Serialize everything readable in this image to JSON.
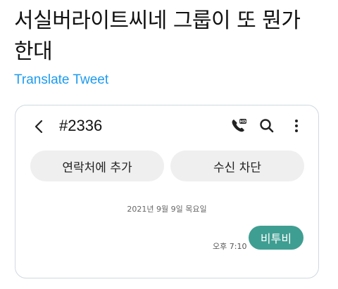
{
  "tweet": {
    "text": "서실버라이트씨네 그룹이 또 뭔가 한대",
    "translate_label": "Translate Tweet"
  },
  "screenshot": {
    "header": {
      "contact_number": "#2336",
      "icons": [
        "back-icon",
        "hd-call-icon",
        "search-icon",
        "more-vertical-icon"
      ]
    },
    "actions": {
      "add_contact_label": "연락처에 추가",
      "block_label": "수신 차단"
    },
    "conversation": {
      "date_label": "2021년 9월 9일 목요일",
      "message": {
        "time": "오후 7:10",
        "text": "비투비"
      }
    },
    "colors": {
      "bubble": "#3f9e92",
      "pill": "#efefef",
      "link": "#1d9bf0"
    }
  }
}
